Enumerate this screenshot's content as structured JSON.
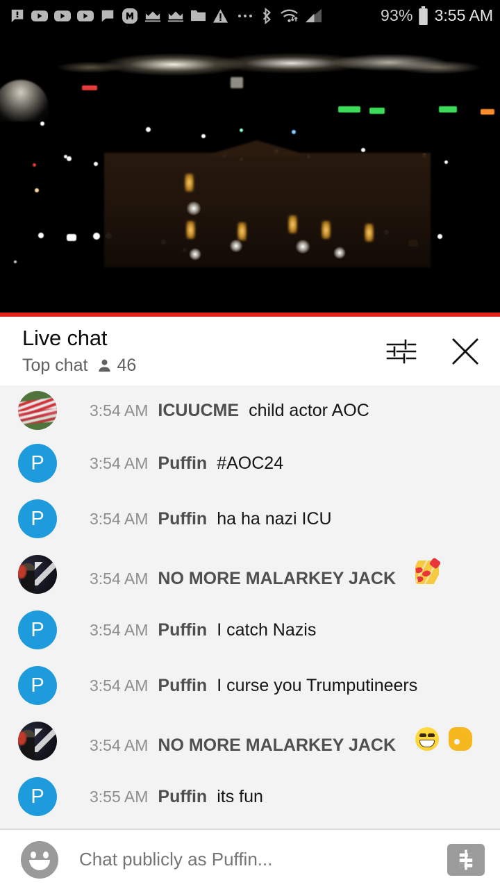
{
  "status_bar": {
    "icons": [
      "message-alert-icon",
      "youtube-icon",
      "youtube-icon",
      "youtube-icon",
      "message-icon",
      "m-badge-icon",
      "crown-icon",
      "crown-icon",
      "folder-icon",
      "warning-triangle-icon",
      "more-dots-icon",
      "bluetooth-icon",
      "wifi-transfer-icon",
      "signal-icon"
    ],
    "battery_percent": "93%",
    "battery_icon": "battery-full-icon",
    "time": "3:55 AM"
  },
  "video": {
    "name": "live-stream-night-webcam",
    "progress_color": "#e62117",
    "progress_percent": 100
  },
  "chat_header": {
    "title": "Live chat",
    "mode": "Top chat",
    "viewer_icon": "person-icon",
    "viewer_count": "46",
    "tune_icon": "tune-sliders-icon",
    "close_icon": "close-icon"
  },
  "messages": [
    {
      "avatar_type": "flag",
      "avatar_letter": "",
      "time": "3:54 AM",
      "author": "ICUUCME",
      "text": "child actor AOC",
      "emojis": []
    },
    {
      "avatar_type": "letter",
      "avatar_letter": "P",
      "time": "3:54 AM",
      "author": "Puffin",
      "text": "#AOC24",
      "emojis": []
    },
    {
      "avatar_type": "letter",
      "avatar_letter": "P",
      "time": "3:54 AM",
      "author": "Puffin",
      "text": "ha ha nazi ICU",
      "emojis": []
    },
    {
      "avatar_type": "photo",
      "avatar_letter": "",
      "time": "3:54 AM",
      "author": "NO MORE MALARKEY JACK",
      "text": "",
      "emojis": [
        "nail-polish-emoji"
      ]
    },
    {
      "avatar_type": "letter",
      "avatar_letter": "P",
      "time": "3:54 AM",
      "author": "Puffin",
      "text": "I catch Nazis",
      "emojis": []
    },
    {
      "avatar_type": "letter",
      "avatar_letter": "P",
      "time": "3:54 AM",
      "author": "Puffin",
      "text": "I curse you Trumputineers",
      "emojis": []
    },
    {
      "avatar_type": "photo",
      "avatar_letter": "",
      "time": "3:54 AM",
      "author": "NO MORE MALARKEY JACK",
      "text": "",
      "emojis": [
        "grinning-face-emoji",
        "ok-hand-emoji"
      ]
    },
    {
      "avatar_type": "letter",
      "avatar_letter": "P",
      "time": "3:55 AM",
      "author": "Puffin",
      "text": "its fun",
      "emojis": []
    }
  ],
  "input_bar": {
    "emoji_button_icon": "smiley-face-icon",
    "placeholder": "Chat publicly as Puffin...",
    "value": "",
    "superchat_icon": "dollar-sign-icon"
  },
  "colors": {
    "accent_red": "#e62117",
    "avatar_blue": "#1e9bdd",
    "chat_bg": "#f3f3f3",
    "status_bar_bg": "#000000"
  }
}
